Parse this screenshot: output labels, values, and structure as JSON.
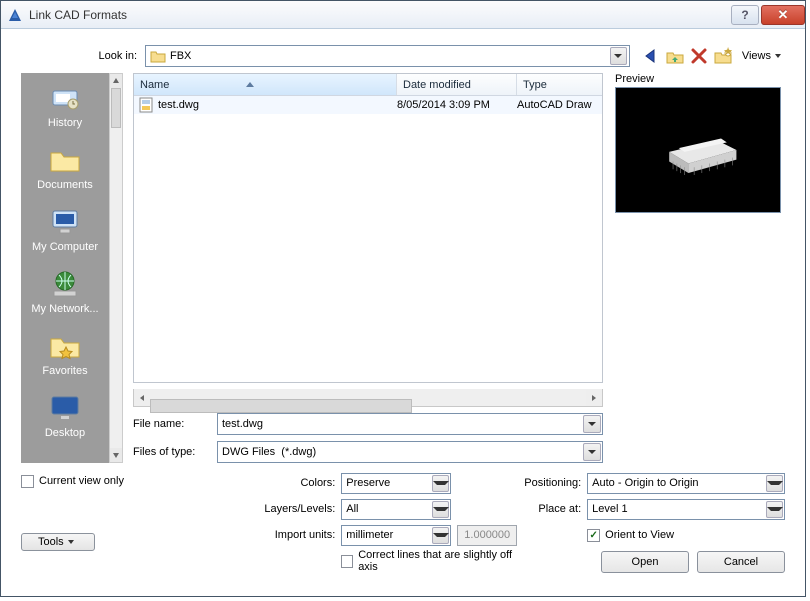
{
  "window": {
    "title": "Link CAD Formats"
  },
  "lookin": {
    "label": "Look in:",
    "value": "FBX"
  },
  "toolbar": {
    "views_label": "Views"
  },
  "preview": {
    "label": "Preview"
  },
  "places": [
    {
      "label": "History"
    },
    {
      "label": "Documents"
    },
    {
      "label": "My Computer"
    },
    {
      "label": "My Network..."
    },
    {
      "label": "Favorites"
    },
    {
      "label": "Desktop"
    }
  ],
  "columns": {
    "name": "Name",
    "date": "Date modified",
    "type": "Type"
  },
  "rows": [
    {
      "name": "test.dwg",
      "date": "8/05/2014 3:09 PM",
      "type": "AutoCAD Draw"
    }
  ],
  "filename": {
    "label": "File name:",
    "value": "test.dwg"
  },
  "filetype": {
    "label": "Files of type:",
    "value": "DWG Files  (*.dwg)"
  },
  "left": {
    "current_view_only": "Current view only",
    "tools": "Tools"
  },
  "mid": {
    "colors_label": "Colors:",
    "colors_value": "Preserve",
    "layers_label": "Layers/Levels:",
    "layers_value": "All",
    "units_label": "Import units:",
    "units_value": "millimeter",
    "units_scale": "1.000000",
    "correct_lines": "Correct lines that are slightly off axis"
  },
  "right": {
    "pos_label": "Positioning:",
    "pos_value": "Auto - Origin to Origin",
    "place_label": "Place at:",
    "place_value": "Level 1",
    "orient": "Orient to View"
  },
  "buttons": {
    "open": "Open",
    "cancel": "Cancel"
  }
}
